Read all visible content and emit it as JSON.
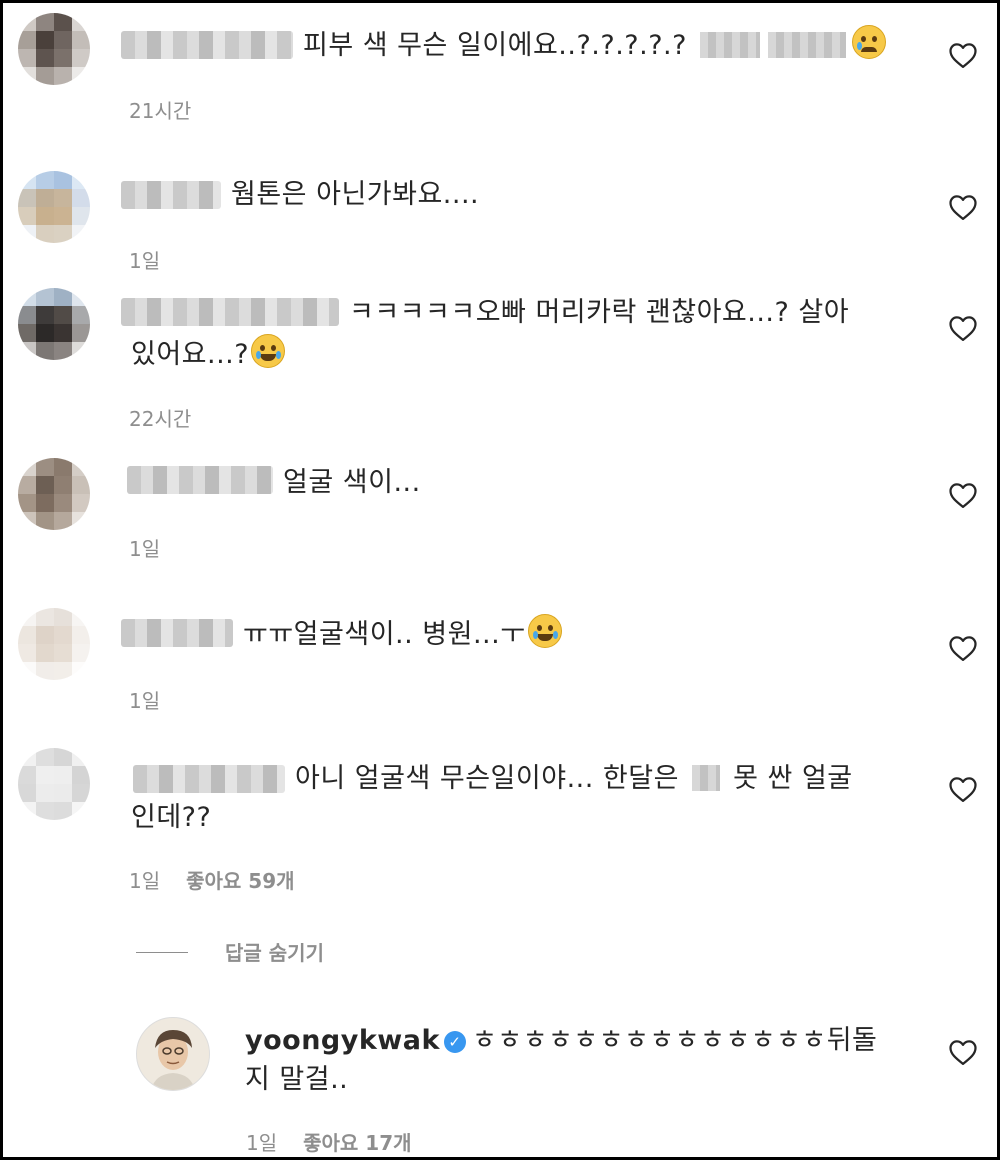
{
  "comments": [
    {
      "text": "피부 색 무슨 일이에요..?.?.?.?.?",
      "emoji": "sad-tear-emoji",
      "time": "21시간",
      "avatar_colors": [
        "#cfc9c4",
        "#8e8580",
        "#5b514c",
        "#d9d5d2",
        "#a79f98",
        "#4a403b",
        "#6f6560",
        "#c3bdb8",
        "#bdb6b1",
        "#5e544f",
        "#7b716b",
        "#cfcac6",
        "#e2dfdc",
        "#a49c96",
        "#b9b2ad",
        "#eceae8"
      ]
    },
    {
      "text": "웜톤은 아닌가봐요....",
      "time": "1일",
      "avatar_colors": [
        "#d6e4f2",
        "#b7cde6",
        "#a9c2e0",
        "#dce8f4",
        "#c9c3b8",
        "#bfae96",
        "#c7b59c",
        "#d3dcea",
        "#d8cdbb",
        "#c8b08e",
        "#cbb392",
        "#dfe5ec",
        "#eef1f5",
        "#d9cfbf",
        "#dad1c2",
        "#f1f3f6"
      ]
    },
    {
      "text_line1": "ㅋㅋㅋㅋㅋ오빠 머리카락 괜찮아요...? 살아",
      "text_line2": "있어요...?",
      "time": "22시간",
      "avatar_colors": [
        "#d2dde8",
        "#b4c3d3",
        "#9fb1c4",
        "#dfe6ee",
        "#8a8c8f",
        "#3e3b3a",
        "#514b47",
        "#a8a9ab",
        "#6f6a66",
        "#2c2928",
        "#3a3432",
        "#9b9795",
        "#c9c6c4",
        "#7c7774",
        "#8a8481",
        "#dedcda"
      ]
    },
    {
      "text": "얼굴 색이...",
      "time": "1일",
      "avatar_colors": [
        "#d9d3cd",
        "#9c8e82",
        "#8a7a6d",
        "#d4cdc6",
        "#b8aca1",
        "#6d5f54",
        "#8f7f72",
        "#c9c0b7",
        "#a39486",
        "#7d6c5f",
        "#9a8a7d",
        "#d2c9c1",
        "#cdc4bb",
        "#a29486",
        "#b5a89c",
        "#e7e2dd"
      ]
    },
    {
      "text_before": "ㅠㅠ얼굴색이.. 병원...ㅜ",
      "time": "1일",
      "avatar_colors": [
        "#f6f4f2",
        "#ebe6e1",
        "#e6e0da",
        "#f7f5f3",
        "#ece6df",
        "#ded3c8",
        "#e3d9cf",
        "#f3efeb",
        "#efe9e3",
        "#e2d8cd",
        "#e6ddd3",
        "#f5f2ef",
        "#fbfaf9",
        "#f1ede9",
        "#f2eee9",
        "#fdfcfb"
      ]
    },
    {
      "text_line1_a": "아니 얼굴색 무슨일이야... 한달은",
      "text_line1_b": "못 싼 얼굴",
      "text_line2": "인데??",
      "time": "1일",
      "likes": "좋아요 59개",
      "avatar_colors": [
        "#f1f1f1",
        "#dedede",
        "#d6d6d6",
        "#f0f0f0",
        "#dadada",
        "#efefef",
        "#eeeeee",
        "#d4d4d4",
        "#d8d8d8",
        "#ececec",
        "#ebebeb",
        "#d6d6d6",
        "#f3f3f3",
        "#dedede",
        "#dcdcdc",
        "#f5f5f5"
      ]
    }
  ],
  "hide_replies": "답글 숨기기",
  "reply": {
    "username": "yoongykwak",
    "verified_mark": "✓",
    "text_line1": "ㅎㅎㅎㅎㅎㅎㅎㅎㅎㅎㅎㅎㅎㅎ뒤돌",
    "text_line2": "지 말걸..",
    "time": "1일",
    "likes": "좋아요 17개"
  },
  "colors": {
    "text": "#262626",
    "meta": "#8e8e8e",
    "verified": "#3897f0"
  }
}
